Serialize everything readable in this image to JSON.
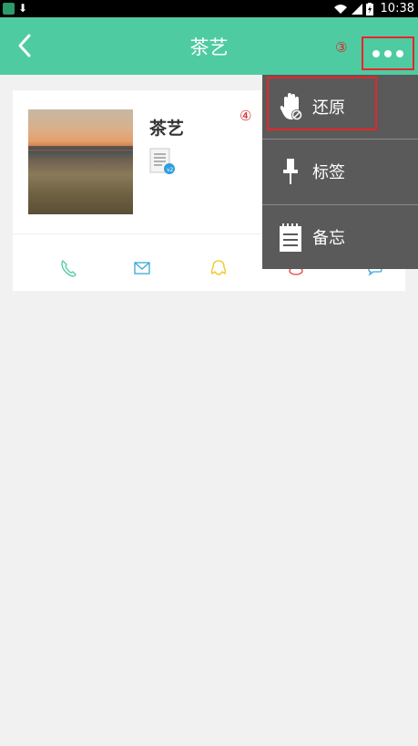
{
  "status_bar": {
    "time": "10:38"
  },
  "header": {
    "title": "茶艺"
  },
  "annotations": {
    "step3": "③",
    "step4": "④"
  },
  "contact": {
    "name": "茶艺"
  },
  "actions": [
    {
      "icon": "phone-icon"
    },
    {
      "icon": "email-icon"
    },
    {
      "icon": "qq-icon"
    },
    {
      "icon": "weibo-icon"
    },
    {
      "icon": "chat-icon"
    }
  ],
  "menu": {
    "items": [
      {
        "label": "还原",
        "icon": "hand-restore-icon"
      },
      {
        "label": "标签",
        "icon": "pushpin-icon"
      },
      {
        "label": "备忘",
        "icon": "notepad-icon"
      }
    ]
  },
  "colors": {
    "accent": "#4fcba2",
    "menu_bg": "#5a5a5a",
    "highlight": "#e8252a"
  }
}
